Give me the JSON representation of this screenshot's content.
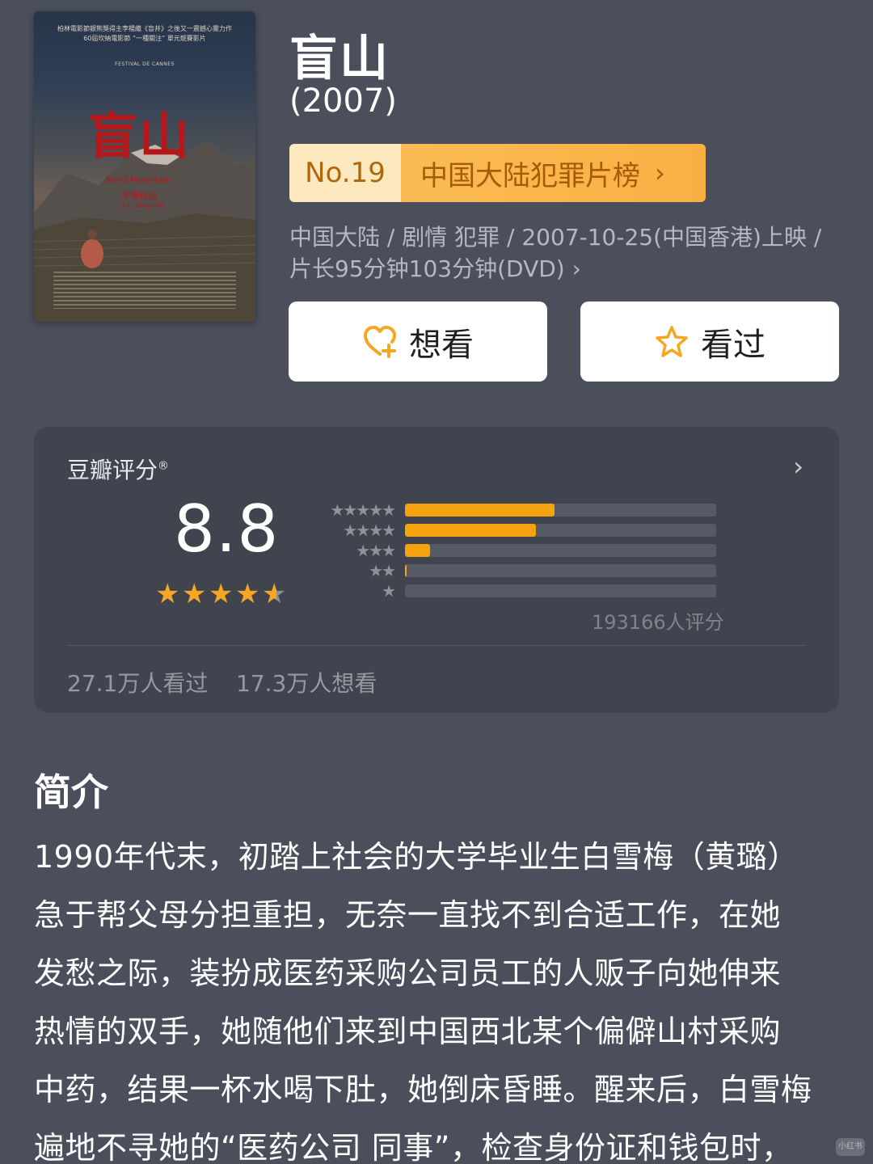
{
  "poster": {
    "title": "盲山",
    "top_text_1": "柏林電影節銀熊獎得主李楊繼《盲井》之後又一震撼心靈力作",
    "top_text_2": "60屆坎納電影節 “一種關注” 單元競賽影片",
    "festival": "FESTIVAL DE CANNES",
    "en_title": "Blind Mountain",
    "director_cn": "李楊作品",
    "director_en": "A Li Yang Film"
  },
  "movie": {
    "title": "盲山",
    "year": "(2007)"
  },
  "rank": {
    "number": "No.19",
    "list_name": "中国大陆犯罪片榜",
    "chevron": "›"
  },
  "meta_text": "中国大陆 / 剧情 犯罪 / 2007-10-25(中国香港)上映 / 片长95分钟103分钟(DVD) ›",
  "actions": {
    "want_label": "想看",
    "seen_label": "看过"
  },
  "rating": {
    "label": "豆瓣评分",
    "registered": "®",
    "score": "8.8",
    "stars": 4.5,
    "distribution": [
      {
        "stars": "★★★★★",
        "fraction": 0.48
      },
      {
        "stars": "★★★★",
        "fraction": 0.42
      },
      {
        "stars": "★★★",
        "fraction": 0.08
      },
      {
        "stars": "★★",
        "fraction": 0.005
      },
      {
        "stars": "★",
        "fraction": 0.0
      }
    ],
    "count_text": "193166人评分",
    "watched": "27.1万人看过",
    "want": "17.3万人想看",
    "accent_color": "#f5a40f"
  },
  "intro": {
    "heading": "简介",
    "lines": [
      "1990年代末，初踏上社会的大学毕业生白雪梅（黄璐）",
      "急于帮父母分担重担，无奈一直找不到合适工作，在她",
      "发愁之际，装扮成医药采购公司员工的人贩子向她伸来",
      "热情的双手，她随他们来到中国西北某个偏僻山村采购",
      "中药，结果一杯水喝下肚，她倒床昏睡。醒来后，白雪梅",
      "遍地不寻她的“医药公司 同事”，检查身份证和钱包时，"
    ]
  },
  "watermark": "小红书"
}
